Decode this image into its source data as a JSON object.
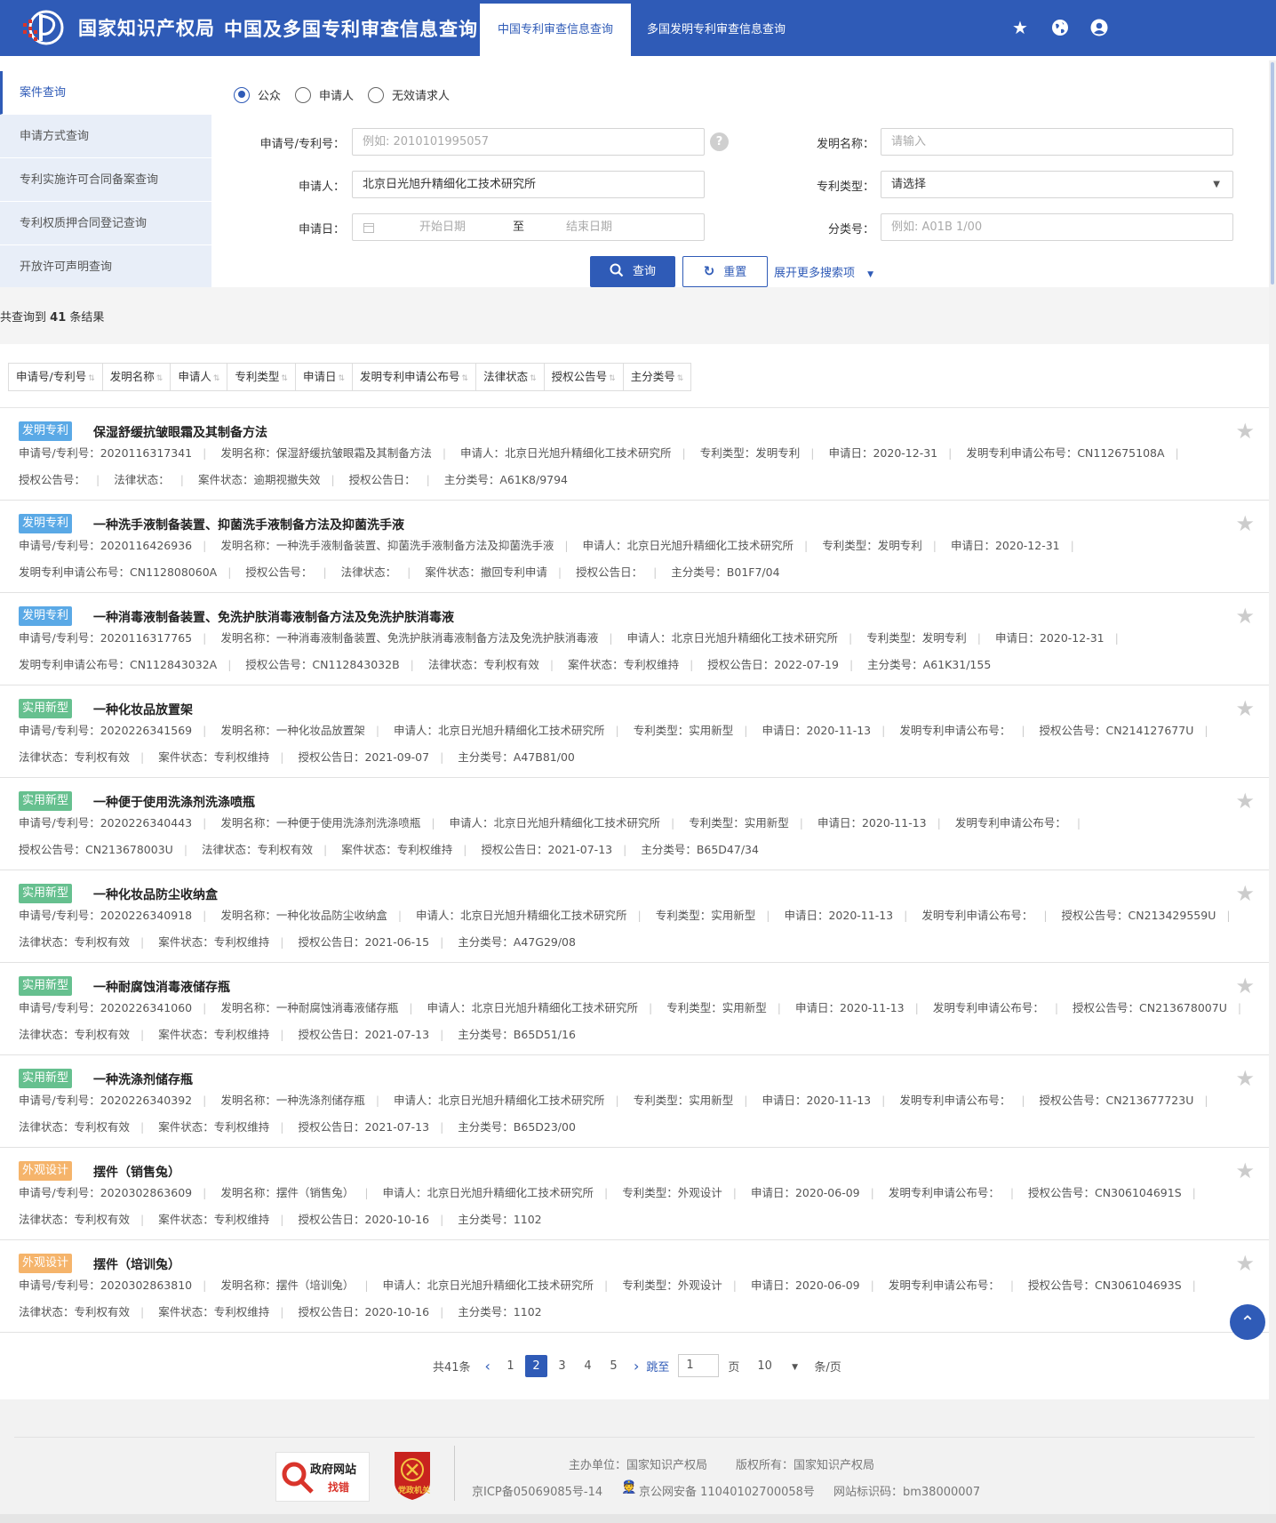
{
  "header": {
    "org_name": "国家知识产权局",
    "system_name": "中国及多国专利审查信息查询",
    "tabs": [
      "中国专利审查信息查询",
      "多国发明专利审查信息查询"
    ]
  },
  "sidebar": {
    "items": [
      {
        "label": "案件查询",
        "active": true
      },
      {
        "label": "申请方式查询"
      },
      {
        "label": "专利实施许可合同备案查询"
      },
      {
        "label": "专利权质押合同登记查询"
      },
      {
        "label": "开放许可声明查询"
      }
    ]
  },
  "form": {
    "radios": [
      "公众",
      "申请人",
      "无效请求人"
    ],
    "app_no_label": "申请号/专利号：",
    "app_no_placeholder": "例如: 2010101995057",
    "invention_name_label": "发明名称：",
    "invention_name_placeholder": "请输入",
    "applicant_label": "申请人：",
    "applicant_value": "北京日光旭升精细化工技术研究所",
    "patent_type_label": "专利类型：",
    "patent_type_value": "请选择",
    "app_date_label": "申请日：",
    "start_date_placeholder": "开始日期",
    "date_to": "至",
    "end_date_placeholder": "结束日期",
    "class_label": "分类号：",
    "class_placeholder": "例如: A01B 1/00",
    "search_label": "查询",
    "reset_label": "重置",
    "more_label": "展开更多搜索项"
  },
  "results": {
    "count_prefix": "共查询到",
    "count": "41",
    "count_suffix": "条结果",
    "sort_columns": [
      "申请号/专利号",
      "发明名称",
      "申请人",
      "专利类型",
      "申请日",
      "发明专利申请公布号",
      "法律状态",
      "授权公告号",
      "主分类号"
    ],
    "items": [
      {
        "tag": "发明专利",
        "tag_type": "invention",
        "title": "保湿舒缓抗皱眼霜及其制备方法",
        "meta": [
          "申请号/专利号：2020116317341",
          "发明名称：保湿舒缓抗皱眼霜及其制备方法",
          "申请人：北京日光旭升精细化工技术研究所",
          "专利类型：发明专利",
          "申请日：2020-12-31",
          "发明专利申请公布号：CN112675108A",
          "授权公告号：",
          "法律状态：",
          "案件状态：逾期视撤失效",
          "授权公告日：",
          "主分类号：A61K8/9794"
        ]
      },
      {
        "tag": "发明专利",
        "tag_type": "invention",
        "title": "一种洗手液制备装置、抑菌洗手液制备方法及抑菌洗手液",
        "meta": [
          "申请号/专利号：2020116426936",
          "发明名称：一种洗手液制备装置、抑菌洗手液制备方法及抑菌洗手液",
          "申请人：北京日光旭升精细化工技术研究所",
          "专利类型：发明专利",
          "申请日：2020-12-31",
          "发明专利申请公布号：CN112808060A",
          "授权公告号：",
          "法律状态：",
          "案件状态：撤回专利申请",
          "授权公告日：",
          "主分类号：B01F7/04"
        ]
      },
      {
        "tag": "发明专利",
        "tag_type": "invention",
        "title": "一种消毒液制备装置、免洗护肤消毒液制备方法及免洗护肤消毒液",
        "meta": [
          "申请号/专利号：2020116317765",
          "发明名称：一种消毒液制备装置、免洗护肤消毒液制备方法及免洗护肤消毒液",
          "申请人：北京日光旭升精细化工技术研究所",
          "专利类型：发明专利",
          "申请日：2020-12-31",
          "发明专利申请公布号：CN112843032A",
          "授权公告号：CN112843032B",
          "法律状态：专利权有效",
          "案件状态：专利权维持",
          "授权公告日：2022-07-19",
          "主分类号：A61K31/155"
        ]
      },
      {
        "tag": "实用新型",
        "tag_type": "utility",
        "title": "一种化妆品放置架",
        "meta": [
          "申请号/专利号：2020226341569",
          "发明名称：一种化妆品放置架",
          "申请人：北京日光旭升精细化工技术研究所",
          "专利类型：实用新型",
          "申请日：2020-11-13",
          "发明专利申请公布号：",
          "授权公告号：CN214127677U",
          "法律状态：专利权有效",
          "案件状态：专利权维持",
          "授权公告日：2021-09-07",
          "主分类号：A47B81/00"
        ]
      },
      {
        "tag": "实用新型",
        "tag_type": "utility",
        "title": "一种便于使用洗涤剂洗涤喷瓶",
        "meta": [
          "申请号/专利号：2020226340443",
          "发明名称：一种便于使用洗涤剂洗涤喷瓶",
          "申请人：北京日光旭升精细化工技术研究所",
          "专利类型：实用新型",
          "申请日：2020-11-13",
          "发明专利申请公布号：",
          "授权公告号：CN213678003U",
          "法律状态：专利权有效",
          "案件状态：专利权维持",
          "授权公告日：2021-07-13",
          "主分类号：B65D47/34"
        ]
      },
      {
        "tag": "实用新型",
        "tag_type": "utility",
        "title": "一种化妆品防尘收纳盒",
        "meta": [
          "申请号/专利号：2020226340918",
          "发明名称：一种化妆品防尘收纳盒",
          "申请人：北京日光旭升精细化工技术研究所",
          "专利类型：实用新型",
          "申请日：2020-11-13",
          "发明专利申请公布号：",
          "授权公告号：CN213429559U",
          "法律状态：专利权有效",
          "案件状态：专利权维持",
          "授权公告日：2021-06-15",
          "主分类号：A47G29/08"
        ]
      },
      {
        "tag": "实用新型",
        "tag_type": "utility",
        "title": "一种耐腐蚀消毒液储存瓶",
        "meta": [
          "申请号/专利号：2020226341060",
          "发明名称：一种耐腐蚀消毒液储存瓶",
          "申请人：北京日光旭升精细化工技术研究所",
          "专利类型：实用新型",
          "申请日：2020-11-13",
          "发明专利申请公布号：",
          "授权公告号：CN213678007U",
          "法律状态：专利权有效",
          "案件状态：专利权维持",
          "授权公告日：2021-07-13",
          "主分类号：B65D51/16"
        ]
      },
      {
        "tag": "实用新型",
        "tag_type": "utility",
        "title": "一种洗涤剂储存瓶",
        "meta": [
          "申请号/专利号：2020226340392",
          "发明名称：一种洗涤剂储存瓶",
          "申请人：北京日光旭升精细化工技术研究所",
          "专利类型：实用新型",
          "申请日：2020-11-13",
          "发明专利申请公布号：",
          "授权公告号：CN213677723U",
          "法律状态：专利权有效",
          "案件状态：专利权维持",
          "授权公告日：2021-07-13",
          "主分类号：B65D23/00"
        ]
      },
      {
        "tag": "外观设计",
        "tag_type": "design",
        "title": "摆件（销售兔）",
        "meta": [
          "申请号/专利号：2020302863609",
          "发明名称：摆件（销售兔）",
          "申请人：北京日光旭升精细化工技术研究所",
          "专利类型：外观设计",
          "申请日：2020-06-09",
          "发明专利申请公布号：",
          "授权公告号：CN306104691S",
          "法律状态：专利权有效",
          "案件状态：专利权维持",
          "授权公告日：2020-10-16",
          "主分类号：1102"
        ]
      },
      {
        "tag": "外观设计",
        "tag_type": "design",
        "title": "摆件（培训兔）",
        "meta": [
          "申请号/专利号：2020302863810",
          "发明名称：摆件（培训兔）",
          "申请人：北京日光旭升精细化工技术研究所",
          "专利类型：外观设计",
          "申请日：2020-06-09",
          "发明专利申请公布号：",
          "授权公告号：CN306104693S",
          "法律状态：专利权有效",
          "案件状态：专利权维持",
          "授权公告日：2020-10-16",
          "主分类号：1102"
        ]
      }
    ]
  },
  "pagination": {
    "total": "共41条",
    "pages": [
      "1",
      "2",
      "3",
      "4",
      "5"
    ],
    "current": "2",
    "jump_label": "跳至",
    "jump_value": "1",
    "page_unit": "页",
    "page_size": "10",
    "per_page_unit": "条/页"
  },
  "footer": {
    "gov_site_label": "政府网站",
    "gov_site_sub": "找错",
    "party_label": "党政机关",
    "sponsor": "主办单位：国家知识产权局",
    "copyright": "版权所有：国家知识产权局",
    "icp": "京ICP备05069085号-14",
    "police": "京公网安备 11040102700058号",
    "site_code": "网站标识码：bm38000007"
  },
  "colors": {
    "brand_blue": "#2f5bb7",
    "invention_tag": "#5aa9e6",
    "utility_tag": "#66c08f",
    "design_tag": "#f5b46b"
  }
}
